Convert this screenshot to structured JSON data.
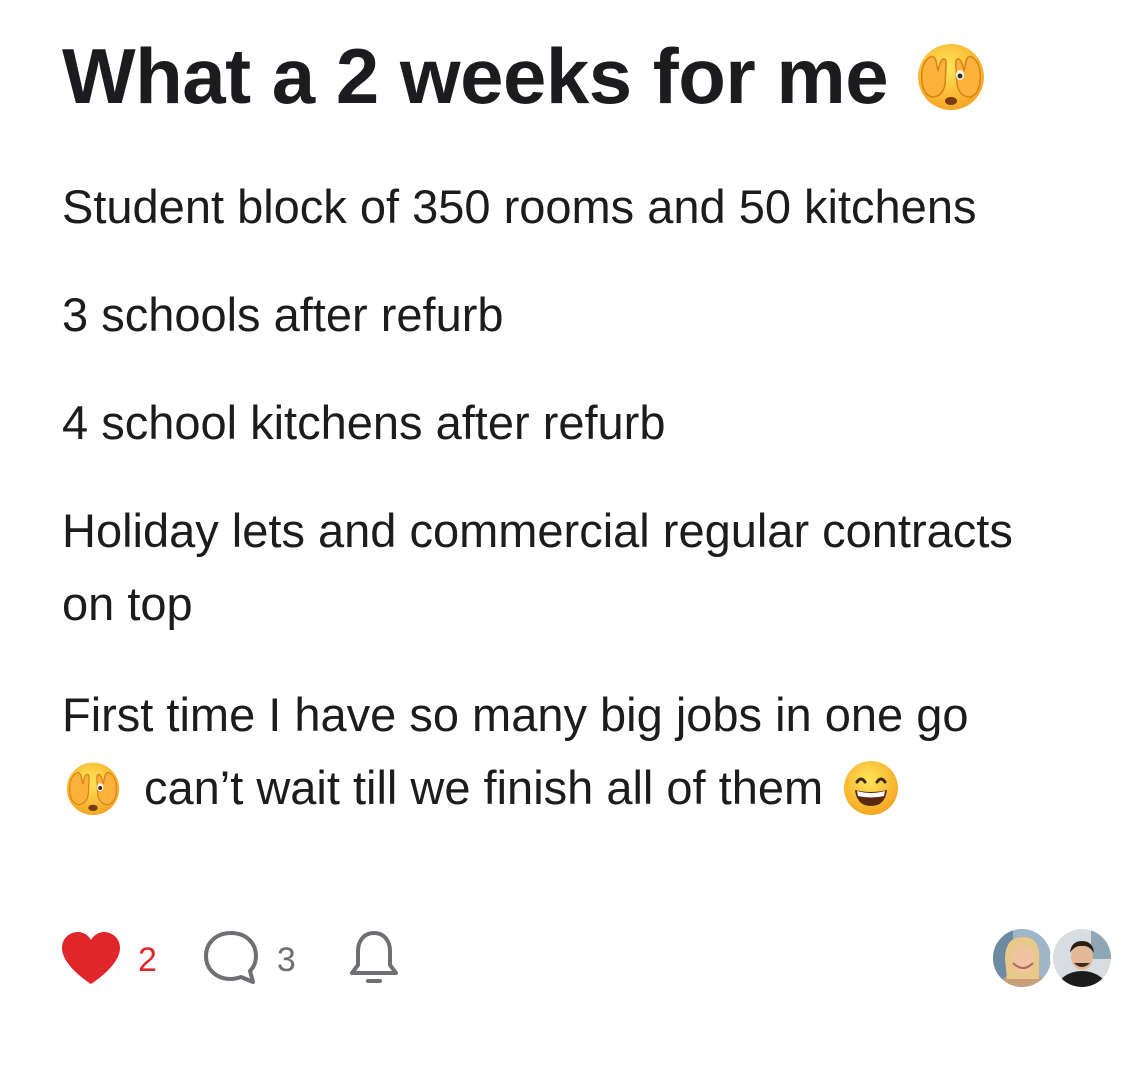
{
  "post": {
    "title": "What a 2 weeks for me",
    "paragraphs": {
      "p1": "Student block of 350 rooms and 50 kitchens",
      "p2": "3 schools after refurb",
      "p3": "4 school kitchens after refurb",
      "p4_line1": "Holiday lets and commercial regular contracts",
      "p4_line2": "on top",
      "p5_line1": "First time I have so many big jobs in one go",
      "p5_line2": "can’t wait till we finish all of them"
    },
    "emojis": {
      "title_emoji": "face-with-peeking-eye",
      "line_emoji": "face-with-peeking-eye",
      "end_emoji": "grinning-face-with-smiling-eyes"
    }
  },
  "footer": {
    "likes": "2",
    "comments": "3",
    "like_icon": "heart-icon",
    "comment_icon": "comment-bubble-icon",
    "subscribe_icon": "bell-icon",
    "like_color": "#e0262b",
    "muted_color": "#6e6e73"
  }
}
